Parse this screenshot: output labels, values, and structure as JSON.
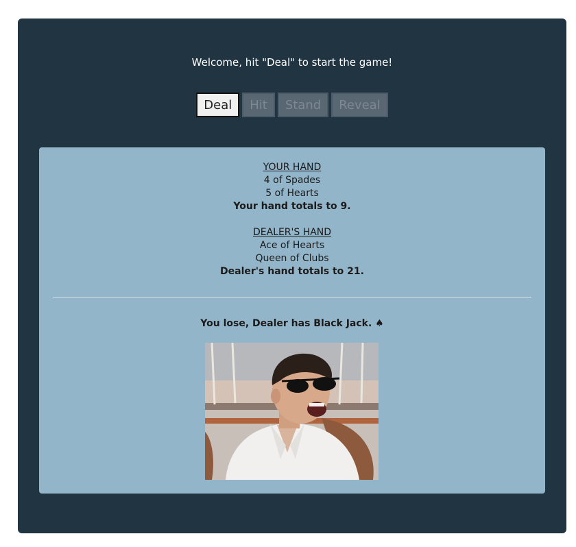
{
  "header": {
    "welcome": "Welcome, hit \"Deal\" to start the game!"
  },
  "controls": {
    "deal": "Deal",
    "hit": "Hit",
    "stand": "Stand",
    "reveal": "Reveal"
  },
  "player": {
    "title": "YOUR HAND",
    "cards": [
      "4 of Spades",
      "5 of Hearts"
    ],
    "total": "Your hand totals to 9."
  },
  "dealer": {
    "title": "DEALER'S HAND",
    "cards": [
      "Ace of Hearts",
      "Queen of Clubs"
    ],
    "total": "Dealer's hand totals to 21."
  },
  "result": {
    "text": "You lose, Dealer has Black Jack. ♠"
  },
  "colors": {
    "background": "#203441",
    "panel": "#93b5ca",
    "button_active": "#f0f0f0",
    "button_disabled": "#586772"
  }
}
